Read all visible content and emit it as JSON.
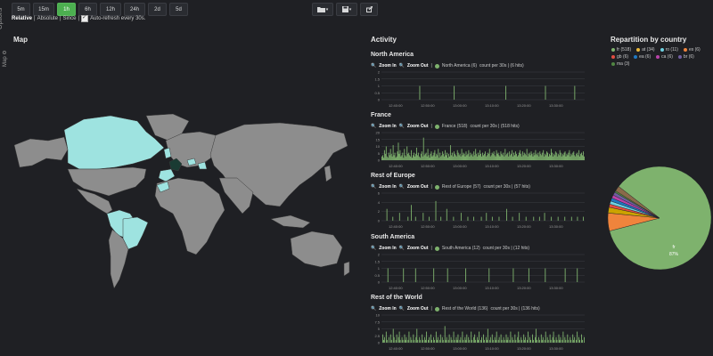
{
  "toolbar": {
    "options_label": "Options",
    "time_buttons": [
      "5m",
      "15m",
      "1h",
      "6h",
      "12h",
      "24h",
      "2d",
      "5d"
    ],
    "active_time": "1h",
    "mode_relative": "Relative",
    "mode_absolute": "Absolute",
    "mode_since": "Since",
    "auto_refresh": "Auto-refresh every 30s."
  },
  "map": {
    "title": "Map",
    "side_label": "Map"
  },
  "activity": {
    "title": "Activity",
    "zoom_in": "Zoom In",
    "zoom_out": "Zoom Out",
    "x_ticks": [
      "12:40:00",
      "12:50:00",
      "13:00:00",
      "13:10:00",
      "13:20:00",
      "13:30:00"
    ],
    "bar_color": "#7eb26d",
    "panels": [
      {
        "title": "North America",
        "legend": "North America (6)",
        "count": "count per 30s | (6 hits)",
        "y_ticks": [
          "2",
          "1.5",
          "1",
          "0.5",
          "0"
        ],
        "ymax": 2,
        "values": [
          0,
          0,
          0,
          0,
          0,
          0,
          0,
          0,
          0,
          0,
          0,
          0,
          0,
          0,
          0,
          0,
          0,
          0,
          0,
          0,
          0,
          0,
          0,
          0,
          0,
          0,
          0,
          0,
          0,
          0,
          0,
          0,
          0,
          0,
          0,
          0,
          0,
          0,
          0,
          0,
          0,
          0,
          0,
          0,
          1,
          0,
          0,
          0,
          0,
          0,
          0,
          0,
          0,
          0,
          0,
          0,
          0,
          0,
          0,
          0,
          0,
          0,
          0,
          0,
          0,
          0,
          0,
          0,
          0,
          0,
          0,
          0,
          0,
          0,
          0,
          0,
          0,
          0,
          0,
          0,
          0,
          0,
          0,
          0,
          1,
          0,
          0,
          0,
          0,
          0,
          0,
          0,
          0,
          0,
          0,
          0,
          0,
          0,
          0,
          0,
          0,
          0,
          0,
          0,
          0,
          0,
          0,
          0,
          0,
          0,
          0,
          0,
          0,
          0,
          0,
          0,
          0,
          0,
          0,
          0,
          0,
          0,
          0,
          0,
          0,
          0,
          0,
          0,
          0,
          0,
          0,
          0,
          0,
          0,
          0,
          0,
          0,
          0,
          0,
          0,
          0,
          0,
          0,
          0,
          1,
          0,
          0,
          0,
          0,
          0,
          0,
          0,
          0,
          0,
          0,
          0,
          0,
          0,
          0,
          0,
          0,
          0,
          0,
          0,
          0,
          0,
          0,
          0,
          0,
          0,
          0,
          0,
          0,
          0,
          0,
          0,
          0,
          0,
          0,
          0,
          0,
          0,
          0,
          0,
          0,
          0,
          0,
          0,
          0,
          0,
          1,
          0,
          0,
          0,
          0,
          0,
          0,
          0,
          0,
          0,
          0,
          0,
          0,
          0,
          0,
          0,
          0,
          0,
          0,
          0,
          0,
          0,
          0,
          0,
          0,
          0,
          0,
          0,
          0,
          0,
          0,
          0,
          0,
          0,
          1,
          0,
          0,
          0,
          0,
          0,
          0,
          0,
          0,
          0,
          0,
          0
        ]
      },
      {
        "title": "France",
        "legend": "France (518)",
        "count": "count per 30s | (518 hits)",
        "y_ticks": [
          "20",
          "15",
          "10",
          "5",
          "0"
        ],
        "ymax": 22,
        "values": [
          3,
          4,
          2,
          8,
          5,
          11,
          3,
          2,
          6,
          4,
          9,
          5,
          3,
          12,
          4,
          6,
          2,
          3,
          7,
          14,
          5,
          8,
          3,
          4,
          6,
          2,
          9,
          4,
          3,
          11,
          5,
          6,
          4,
          3,
          8,
          2,
          4,
          6,
          3,
          5,
          10,
          4,
          6,
          3,
          2,
          5,
          7,
          3,
          18,
          4,
          5,
          6,
          3,
          9,
          4,
          2,
          5,
          7,
          3,
          4,
          6,
          8,
          3,
          5,
          4,
          9,
          2,
          6,
          3,
          4,
          7,
          5,
          3,
          8,
          4,
          6,
          2,
          5,
          3,
          12,
          4,
          6,
          3,
          7,
          5,
          4,
          3,
          8,
          6,
          4,
          5,
          3,
          9,
          4,
          6,
          5,
          3,
          7,
          4,
          5,
          8,
          3,
          6,
          4,
          5,
          3,
          7,
          4,
          9,
          5,
          3,
          6,
          4,
          8,
          5,
          3,
          6,
          4,
          5,
          7,
          3,
          4,
          6,
          5,
          9,
          3,
          4,
          6,
          5,
          7,
          4,
          3,
          8,
          5,
          6,
          4,
          3,
          7,
          5,
          4,
          6,
          3,
          9,
          4,
          5,
          6,
          3,
          7,
          4,
          5,
          8,
          3,
          6,
          4,
          7,
          5,
          3,
          4,
          6,
          8,
          5,
          3,
          7,
          4,
          6,
          5,
          4,
          9,
          3,
          5,
          6,
          4,
          7,
          5,
          3,
          6,
          4,
          8,
          5,
          4,
          6,
          3,
          7,
          5,
          4,
          6,
          8,
          3,
          5,
          4,
          7,
          6,
          3,
          5,
          4,
          9,
          6,
          3,
          5,
          4,
          7,
          6,
          3,
          5,
          4,
          8,
          6,
          3,
          5,
          4,
          6,
          7,
          3,
          5,
          4,
          6,
          8,
          3,
          5,
          4,
          6,
          7,
          4,
          3,
          5,
          6,
          4,
          8,
          3,
          5,
          6,
          4,
          7,
          3
        ]
      },
      {
        "title": "Rest of Europe",
        "legend": "Rest of Europe (57)",
        "count": "count per 30s | (57 hits)",
        "y_ticks": [
          "6",
          "4",
          "2",
          "0"
        ],
        "ymax": 7,
        "values": [
          0,
          0,
          0,
          0,
          0,
          0,
          3,
          0,
          0,
          0,
          0,
          0,
          0,
          1,
          0,
          0,
          0,
          0,
          0,
          0,
          0,
          2,
          0,
          0,
          0,
          0,
          0,
          0,
          0,
          0,
          0,
          1,
          0,
          0,
          0,
          4,
          0,
          0,
          0,
          0,
          1,
          0,
          0,
          0,
          0,
          0,
          0,
          0,
          0,
          2,
          0,
          0,
          0,
          0,
          0,
          0,
          1,
          0,
          0,
          0,
          0,
          0,
          0,
          0,
          5,
          0,
          0,
          0,
          0,
          0,
          1,
          0,
          0,
          0,
          0,
          0,
          0,
          3,
          0,
          0,
          0,
          0,
          0,
          0,
          0,
          1,
          0,
          0,
          0,
          0,
          0,
          0,
          0,
          0,
          2,
          0,
          0,
          0,
          0,
          0,
          0,
          0,
          1,
          0,
          0,
          0,
          0,
          0,
          0,
          1,
          0,
          0,
          0,
          0,
          0,
          0,
          0,
          0,
          1,
          0,
          0,
          0,
          0,
          0,
          2,
          0,
          0,
          0,
          0,
          0,
          0,
          1,
          0,
          0,
          0,
          0,
          0,
          0,
          0,
          1,
          0,
          0,
          0,
          0,
          0,
          0,
          0,
          0,
          3,
          0,
          0,
          0,
          0,
          0,
          0,
          1,
          0,
          0,
          0,
          0,
          0,
          0,
          0,
          2,
          0,
          0,
          0,
          0,
          0,
          0,
          0,
          1,
          0,
          0,
          0,
          0,
          0,
          0,
          0,
          0,
          1,
          0,
          0,
          0,
          0,
          0,
          0,
          1,
          0,
          0,
          0,
          0,
          0,
          2,
          0,
          0,
          0,
          0,
          0,
          0,
          0,
          1,
          0,
          0,
          0,
          0,
          0,
          0,
          0,
          1,
          0,
          0,
          0,
          0,
          0,
          0,
          0,
          1,
          0,
          0,
          0,
          0,
          0,
          0,
          0,
          1,
          0,
          0,
          0,
          0,
          0,
          0,
          1,
          0,
          0,
          0,
          0,
          0,
          0,
          1,
          0
        ]
      },
      {
        "title": "South America",
        "legend": "South America (12)",
        "count": "count per 30s | (12 hits)",
        "y_ticks": [
          "2",
          "1.5",
          "1",
          "0.5",
          "0"
        ],
        "ymax": 2,
        "values": [
          0,
          0,
          0,
          0,
          0,
          0,
          0,
          1,
          0,
          0,
          0,
          0,
          0,
          0,
          0,
          0,
          0,
          0,
          0,
          0,
          0,
          0,
          0,
          0,
          0,
          1,
          0,
          0,
          0,
          0,
          0,
          0,
          0,
          0,
          0,
          0,
          0,
          0,
          0,
          1,
          0,
          0,
          0,
          0,
          0,
          0,
          0,
          0,
          0,
          0,
          0,
          0,
          0,
          0,
          0,
          0,
          0,
          0,
          0,
          0,
          1,
          0,
          0,
          0,
          0,
          0,
          0,
          0,
          0,
          0,
          0,
          0,
          0,
          0,
          0,
          0,
          1,
          0,
          0,
          0,
          0,
          0,
          0,
          0,
          0,
          0,
          0,
          0,
          0,
          0,
          0,
          0,
          0,
          0,
          0,
          0,
          0,
          1,
          0,
          0,
          0,
          0,
          0,
          0,
          0,
          0,
          0,
          0,
          0,
          0,
          0,
          0,
          0,
          0,
          0,
          0,
          0,
          0,
          0,
          0,
          0,
          0,
          0,
          0,
          1,
          0,
          0,
          0,
          0,
          0,
          0,
          0,
          0,
          0,
          0,
          0,
          0,
          0,
          0,
          0,
          0,
          0,
          0,
          0,
          0,
          0,
          0,
          0,
          0,
          0,
          0,
          0,
          1,
          0,
          0,
          0,
          0,
          0,
          0,
          0,
          0,
          0,
          0,
          0,
          0,
          0,
          0,
          0,
          0,
          0,
          1,
          0,
          0,
          0,
          0,
          0,
          0,
          0,
          0,
          0,
          0,
          0,
          0,
          0,
          0,
          0,
          0,
          0,
          0,
          1,
          0,
          0,
          0,
          0,
          0,
          0,
          0,
          0,
          0,
          0,
          0,
          0,
          0,
          0,
          0,
          0,
          0,
          0,
          0,
          0,
          0,
          0,
          1,
          0,
          0,
          0,
          0,
          0,
          0,
          0,
          0,
          0,
          0,
          0,
          0,
          0,
          1,
          0,
          0,
          0,
          0,
          0,
          0,
          0,
          0
        ]
      },
      {
        "title": "Rest of the World",
        "legend": "Rest of the World (136)",
        "count": "count per 30s | (136 hits)",
        "y_ticks": [
          "10",
          "7.5",
          "5",
          "2.5",
          "0"
        ],
        "ymax": 10,
        "values": [
          0,
          3,
          1,
          2,
          0,
          4,
          1,
          0,
          2,
          0,
          3,
          1,
          0,
          5,
          2,
          0,
          1,
          3,
          0,
          2,
          4,
          1,
          0,
          2,
          1,
          0,
          3,
          1,
          2,
          0,
          1,
          4,
          0,
          2,
          1,
          0,
          3,
          1,
          0,
          2,
          5,
          1,
          0,
          2,
          1,
          0,
          3,
          1,
          0,
          2,
          1,
          4,
          0,
          1,
          2,
          0,
          3,
          1,
          0,
          2,
          1,
          0,
          4,
          1,
          2,
          0,
          1,
          3,
          0,
          2,
          1,
          0,
          6,
          1,
          2,
          0,
          1,
          3,
          0,
          2,
          1,
          0,
          4,
          1,
          0,
          2,
          1,
          3,
          0,
          1,
          2,
          0,
          4,
          1,
          0,
          2,
          1,
          3,
          0,
          2,
          1,
          0,
          4,
          1,
          0,
          2,
          3,
          1,
          0,
          2,
          1,
          4,
          0,
          1,
          2,
          0,
          3,
          1,
          0,
          2,
          1,
          5,
          0,
          1,
          2,
          0,
          3,
          1,
          0,
          2,
          1,
          4,
          0,
          1,
          2,
          0,
          3,
          1,
          0,
          2,
          1,
          0,
          3,
          1,
          2,
          0,
          1,
          4,
          0,
          2,
          1,
          0,
          3,
          1,
          0,
          2,
          4,
          1,
          0,
          2,
          1,
          0,
          3,
          1,
          2,
          0,
          1,
          4,
          0,
          2,
          1,
          0,
          3,
          1,
          0,
          2,
          5,
          1,
          0,
          2,
          1,
          0,
          3,
          1,
          2,
          0,
          1,
          4,
          0,
          2,
          1,
          0,
          3,
          1,
          0,
          2,
          4,
          1,
          0,
          2,
          1,
          0,
          3,
          1,
          2,
          0,
          1,
          4,
          0,
          2,
          1,
          0,
          3,
          1,
          0,
          2,
          1,
          0,
          3,
          1,
          2,
          0,
          1,
          4,
          0,
          2,
          1,
          0,
          3,
          1,
          0,
          2
        ]
      }
    ]
  },
  "repartition": {
    "title": "Repartition by country",
    "legend": [
      {
        "label": "fr (518)",
        "color": "#7eb26d"
      },
      {
        "label": "at (34)",
        "color": "#eab839"
      },
      {
        "label": "ro (11)",
        "color": "#6ed0e0"
      },
      {
        "label": "es (6)",
        "color": "#ef843c"
      },
      {
        "label": "gb (6)",
        "color": "#e24d42"
      },
      {
        "label": "ea (6)",
        "color": "#1f78c1"
      },
      {
        "label": "ca (6)",
        "color": "#ba43a9"
      },
      {
        "label": "br (6)",
        "color": "#705da0"
      },
      {
        "label": "ma (3)",
        "color": "#508642"
      }
    ],
    "chart_data": {
      "type": "pie",
      "categories": [
        "fr",
        "at",
        "ro",
        "es",
        "gb",
        "ea",
        "ca",
        "br",
        "ma",
        "other"
      ],
      "values": [
        518,
        34,
        11,
        6,
        6,
        6,
        6,
        6,
        3,
        10
      ],
      "colors": [
        "#7eb26d",
        "#ef843c",
        "#cca300",
        "#e24d42",
        "#6ed0e0",
        "#1f78c1",
        "#ba43a9",
        "#705da0",
        "#508642",
        "#8a6a4a"
      ],
      "label_fr": "fr",
      "label_pct": "87%"
    }
  }
}
